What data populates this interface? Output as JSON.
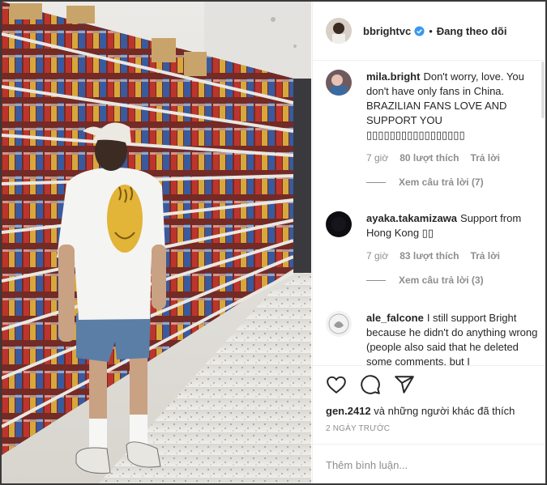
{
  "post": {
    "author": "bbrightvc",
    "dot": "•",
    "follow_status": "Đang theo dõi",
    "photo_caption_hidden": ""
  },
  "comments": [
    {
      "user": "mila.bright",
      "text": "Don't worry, love. You don't have only fans in China. BRAZILIAN FANS LOVE AND SUPPORT YOU ▯▯▯▯▯▯▯▯▯▯▯▯▯▯▯▯▯",
      "time": "7 giờ",
      "likes": "80 lượt thích",
      "reply": "Trả lời",
      "view_replies": "Xem câu trả lời (7)"
    },
    {
      "user": "ayaka.takamizawa",
      "text": "Support from Hong Kong ▯▯",
      "time": "7 giờ",
      "likes": "83 lượt thích",
      "reply": "Trả lời",
      "view_replies": "Xem câu trả lời (3)"
    },
    {
      "user": "ale_falcone",
      "text": "I still support Bright because he didn't do anything wrong (people also said that he deleted some comments, but I",
      "time": "",
      "likes": "",
      "reply": "",
      "view_replies": ""
    }
  ],
  "actions": {
    "liked_by_user": "gen.2412",
    "liked_by_rest": " và những người khác đã thích",
    "time_ago": "2 NGÀY TRƯỚC"
  },
  "add_comment": {
    "placeholder": "Thêm bình luận..."
  },
  "colors": {
    "verified": "#3897f0",
    "text": "#262626",
    "muted": "#8e8e8e",
    "divider": "#efefef"
  },
  "icons": [
    "heart-icon",
    "comment-icon",
    "share-icon",
    "verified-icon"
  ]
}
